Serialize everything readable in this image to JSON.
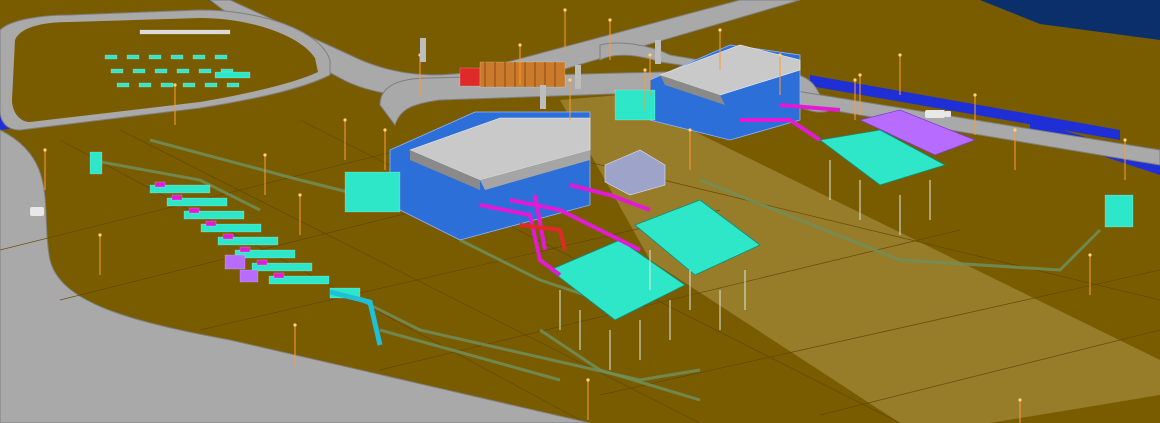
{
  "scene": {
    "kind": "3d-plant-model-viewport",
    "colors": {
      "ground": "#7a5c00",
      "ground_dark": "#5e4600",
      "road": "#a9a9a9",
      "road_edge": "#7f7f7f",
      "wall_blue": "#1f2fd6",
      "water": "#0b2f6a",
      "building_blue": "#2d6fd8",
      "building_roof": "#c9c9c9",
      "equipment_cyan": "#2ee6c8",
      "equipment_magenta": "#e21ad6",
      "equipment_red": "#e02a2a",
      "equipment_purple": "#b86bff",
      "pipe_green": "#6f8f5a",
      "pole_orange": "#ff9b2f"
    },
    "icons": [
      "vehicle-icon",
      "truck-icon"
    ]
  }
}
